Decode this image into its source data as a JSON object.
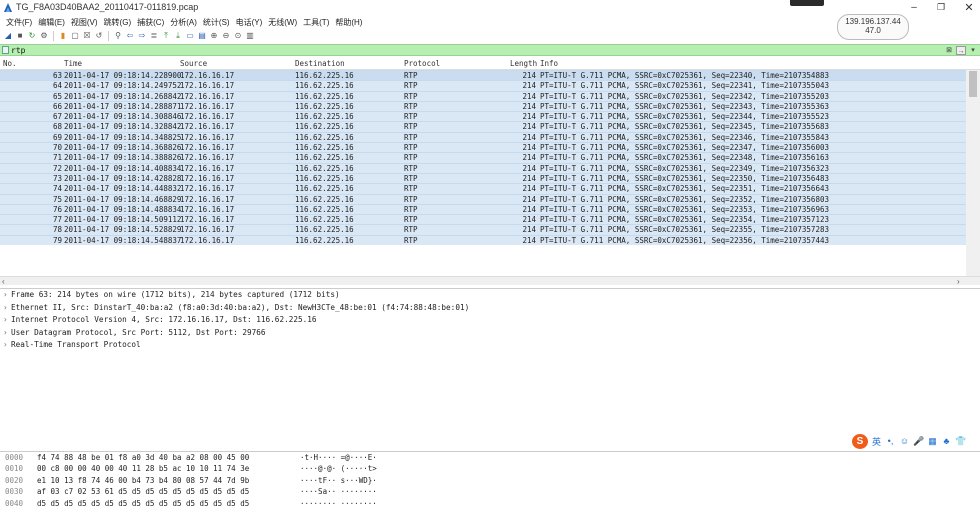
{
  "window": {
    "title": "TG_F8A03D40BAA2_20110417-011819.pcap",
    "ip": "139.196.137.44",
    "ip_sub": "47.0"
  },
  "menu": [
    "文件(F)",
    "编辑(E)",
    "视图(V)",
    "跳转(G)",
    "捕获(C)",
    "分析(A)",
    "统计(S)",
    "电话(Y)",
    "无线(W)",
    "工具(T)",
    "帮助(H)"
  ],
  "filter": {
    "value": "rtp"
  },
  "columns": {
    "no": "No.",
    "time": "Time",
    "source": "Source",
    "destination": "Destination",
    "protocol": "Protocol",
    "length": "Length",
    "info": "Info"
  },
  "packets": [
    {
      "no": "63",
      "time": "2011-04-17 09:18:14.228900",
      "src": "172.16.16.17",
      "dst": "116.62.225.16",
      "proto": "RTP",
      "len": "214",
      "info": "PT=ITU-T G.711 PCMA, SSRC=0xC7025361, Seq=22340, Time=2107354883"
    },
    {
      "no": "64",
      "time": "2011-04-17 09:18:14.249752",
      "src": "172.16.16.17",
      "dst": "116.62.225.16",
      "proto": "RTP",
      "len": "214",
      "info": "PT=ITU-T G.711 PCMA, SSRC=0xC7025361, Seq=22341, Time=2107355043"
    },
    {
      "no": "65",
      "time": "2011-04-17 09:18:14.268842",
      "src": "172.16.16.17",
      "dst": "116.62.225.16",
      "proto": "RTP",
      "len": "214",
      "info": "PT=ITU-T G.711 PCMA, SSRC=0xC7025361, Seq=22342, Time=2107355203"
    },
    {
      "no": "66",
      "time": "2011-04-17 09:18:14.288871",
      "src": "172.16.16.17",
      "dst": "116.62.225.16",
      "proto": "RTP",
      "len": "214",
      "info": "PT=ITU-T G.711 PCMA, SSRC=0xC7025361, Seq=22343, Time=2107355363"
    },
    {
      "no": "67",
      "time": "2011-04-17 09:18:14.308846",
      "src": "172.16.16.17",
      "dst": "116.62.225.16",
      "proto": "RTP",
      "len": "214",
      "info": "PT=ITU-T G.711 PCMA, SSRC=0xC7025361, Seq=22344, Time=2107355523"
    },
    {
      "no": "68",
      "time": "2011-04-17 09:18:14.328842",
      "src": "172.16.16.17",
      "dst": "116.62.225.16",
      "proto": "RTP",
      "len": "214",
      "info": "PT=ITU-T G.711 PCMA, SSRC=0xC7025361, Seq=22345, Time=2107355683"
    },
    {
      "no": "69",
      "time": "2011-04-17 09:18:14.348825",
      "src": "172.16.16.17",
      "dst": "116.62.225.16",
      "proto": "RTP",
      "len": "214",
      "info": "PT=ITU-T G.711 PCMA, SSRC=0xC7025361, Seq=22346, Time=2107355843"
    },
    {
      "no": "70",
      "time": "2011-04-17 09:18:14.368826",
      "src": "172.16.16.17",
      "dst": "116.62.225.16",
      "proto": "RTP",
      "len": "214",
      "info": "PT=ITU-T G.711 PCMA, SSRC=0xC7025361, Seq=22347, Time=2107356003"
    },
    {
      "no": "71",
      "time": "2011-04-17 09:18:14.388826",
      "src": "172.16.16.17",
      "dst": "116.62.225.16",
      "proto": "RTP",
      "len": "214",
      "info": "PT=ITU-T G.711 PCMA, SSRC=0xC7025361, Seq=22348, Time=2107356163"
    },
    {
      "no": "72",
      "time": "2011-04-17 09:18:14.408834",
      "src": "172.16.16.17",
      "dst": "116.62.225.16",
      "proto": "RTP",
      "len": "214",
      "info": "PT=ITU-T G.711 PCMA, SSRC=0xC7025361, Seq=22349, Time=2107356323"
    },
    {
      "no": "73",
      "time": "2011-04-17 09:18:14.428828",
      "src": "172.16.16.17",
      "dst": "116.62.225.16",
      "proto": "RTP",
      "len": "214",
      "info": "PT=ITU-T G.711 PCMA, SSRC=0xC7025361, Seq=22350, Time=2107356483"
    },
    {
      "no": "74",
      "time": "2011-04-17 09:18:14.448832",
      "src": "172.16.16.17",
      "dst": "116.62.225.16",
      "proto": "RTP",
      "len": "214",
      "info": "PT=ITU-T G.711 PCMA, SSRC=0xC7025361, Seq=22351, Time=2107356643"
    },
    {
      "no": "75",
      "time": "2011-04-17 09:18:14.468829",
      "src": "172.16.16.17",
      "dst": "116.62.225.16",
      "proto": "RTP",
      "len": "214",
      "info": "PT=ITU-T G.711 PCMA, SSRC=0xC7025361, Seq=22352, Time=2107356803"
    },
    {
      "no": "76",
      "time": "2011-04-17 09:18:14.488834",
      "src": "172.16.16.17",
      "dst": "116.62.225.16",
      "proto": "RTP",
      "len": "214",
      "info": "PT=ITU-T G.711 PCMA, SSRC=0xC7025361, Seq=22353, Time=2107356963"
    },
    {
      "no": "77",
      "time": "2011-04-17 09:18:14.509112",
      "src": "172.16.16.17",
      "dst": "116.62.225.16",
      "proto": "RTP",
      "len": "214",
      "info": "PT=ITU-T G.711 PCMA, SSRC=0xC7025361, Seq=22354, Time=2107357123"
    },
    {
      "no": "78",
      "time": "2011-04-17 09:18:14.528829",
      "src": "172.16.16.17",
      "dst": "116.62.225.16",
      "proto": "RTP",
      "len": "214",
      "info": "PT=ITU-T G.711 PCMA, SSRC=0xC7025361, Seq=22355, Time=2107357283"
    },
    {
      "no": "79",
      "time": "2011-04-17 09:18:14.548837",
      "src": "172.16.16.17",
      "dst": "116.62.225.16",
      "proto": "RTP",
      "len": "214",
      "info": "PT=ITU-T G.711 PCMA, SSRC=0xC7025361, Seq=22356, Time=2107357443"
    }
  ],
  "details": [
    "Frame 63: 214 bytes on wire (1712 bits), 214 bytes captured (1712 bits)",
    "Ethernet II, Src: DinstarT_40:ba:a2 (f8:a0:3d:40:ba:a2), Dst: NewH3CTe_48:be:01 (f4:74:88:48:be:01)",
    "Internet Protocol Version 4, Src: 172.16.16.17, Dst: 116.62.225.16",
    "User Datagram Protocol, Src Port: 5112, Dst Port: 29766",
    "Real-Time Transport Protocol"
  ],
  "bytes": [
    {
      "offset": "0000",
      "hex": "f4 74 88 48 be 01 f8 a0  3d 40 ba a2 08 00 45 00",
      "ascii": "·t·H···· =@····E·"
    },
    {
      "offset": "0010",
      "hex": "00 c8 00 00 40 00 40 11  28 b5 ac 10 10 11 74 3e",
      "ascii": "····@·@· (·····t>"
    },
    {
      "offset": "0020",
      "hex": "e1 10 13 f8 74 46 00 b4  73 b4 80 08 57 44 7d 9b",
      "ascii": "····tF·· s···WD}·"
    },
    {
      "offset": "0030",
      "hex": "af 03 c7 02 53 61 d5 d5  d5 d5 d5 d5 d5 d5 d5 d5",
      "ascii": "····Sa·· ········"
    },
    {
      "offset": "0040",
      "hex": "d5 d5 d5 d5 d5 d5 d5 d5  d5 d5 d5 d5 d5 d5 d5 d5",
      "ascii": "········ ········"
    }
  ],
  "tray": {
    "ime_logo": "S",
    "ime_lang": "英"
  },
  "colors": {
    "filter_bg": "#b5f0b0",
    "row_bg": "#dae8f5",
    "accent": "#2a5db0"
  }
}
